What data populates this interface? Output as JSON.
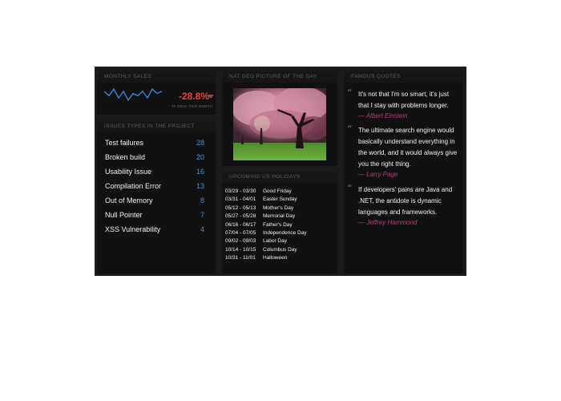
{
  "colors": {
    "negative": "#e8453c",
    "count": "#3d8fe0",
    "author": "#b0407a",
    "sparkline": "#2f8fe6"
  },
  "sales": {
    "title": "MONTHLY SALES",
    "value": "-28.8%",
    "caption": "75 SOLD THIS MONTH",
    "trend_icon": "caret-down-icon",
    "sparkline_points": [
      6,
      4,
      7,
      3,
      6,
      2,
      5,
      4,
      6,
      3,
      7,
      5,
      6
    ]
  },
  "issues": {
    "title": "ISSUES TYPES IN THE PROJECT",
    "items": [
      {
        "label": "Test failures",
        "count": "28"
      },
      {
        "label": "Broken build",
        "count": "20"
      },
      {
        "label": "Usability Issue",
        "count": "16"
      },
      {
        "label": "Compilation Error",
        "count": "13"
      },
      {
        "label": "Out of Memory",
        "count": "8"
      },
      {
        "label": "Null Pointer",
        "count": "7"
      },
      {
        "label": "XSS Vulnerability",
        "count": "4"
      }
    ]
  },
  "picture": {
    "title": "NAT GEO PICTURE OF THE DAY"
  },
  "holidays": {
    "title": "UPCOMING US HOLIDAYS",
    "items": [
      {
        "date": "03/29 - 03/30",
        "name": "Good Friday"
      },
      {
        "date": "03/31 - 04/01",
        "name": "Easter Sunday"
      },
      {
        "date": "05/12 - 05/13",
        "name": "Mother's Day"
      },
      {
        "date": "05/27 - 05/28",
        "name": "Memorial Day"
      },
      {
        "date": "06/16 - 06/17",
        "name": "Father's Day"
      },
      {
        "date": "07/04 - 07/05",
        "name": "Independence Day"
      },
      {
        "date": "09/02 - 09/03",
        "name": "Labor Day"
      },
      {
        "date": "10/14 - 10/15",
        "name": "Columbus Day"
      },
      {
        "date": "10/31 - 11/01",
        "name": "Halloween"
      }
    ]
  },
  "quotes": {
    "title": "FAMOUS QUOTES",
    "mark": "“",
    "items": [
      {
        "text": "It's not that I'm so smart, it's just that I stay with problems longer.",
        "author": "— Albert Einstein"
      },
      {
        "text": "The ultimate search engine would basically understand everything in the world, and it would always give you the right thing.",
        "author": "— Larry Page"
      },
      {
        "text": "If developers' pains are Java and .NET, the antidote is dynamic languages and frameworks.",
        "author": "— Jeffrey Hammond"
      }
    ]
  }
}
